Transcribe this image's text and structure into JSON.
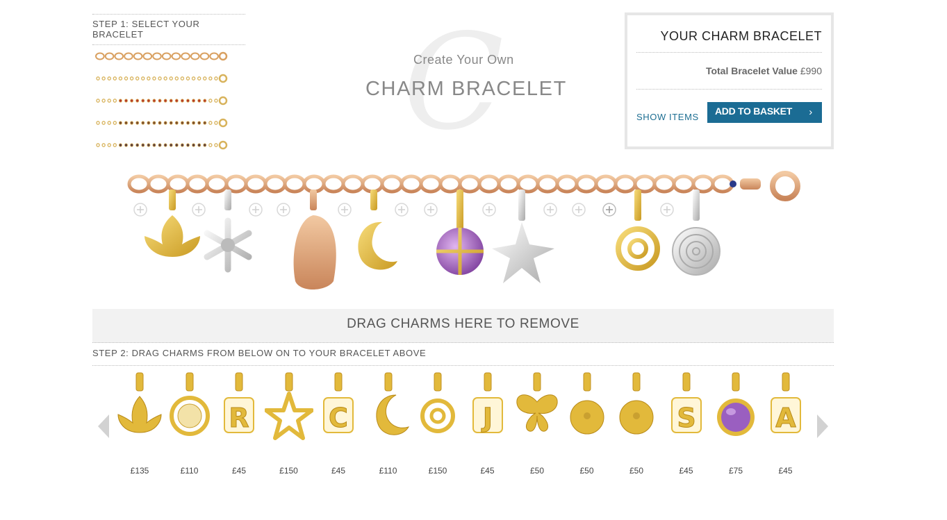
{
  "step1": {
    "title": "STEP 1: SELECT YOUR BRACELET",
    "bracelets": [
      {
        "name": "gold-chain",
        "color": "#d9a060"
      },
      {
        "name": "fine-gold-chain",
        "color": "#d4b060"
      },
      {
        "name": "coral-bead-chain",
        "color": "#b83a28"
      },
      {
        "name": "smoky-bead-chain",
        "color": "#7a4a2a"
      },
      {
        "name": "dark-bead-chain",
        "color": "#5a3a3a"
      }
    ]
  },
  "hero": {
    "line1": "Create Your Own",
    "line2": "CHARM BRACELET",
    "watermark": "C"
  },
  "basket": {
    "title": "YOUR CHARM BRACELET",
    "total_label": "Total Bracelet Value",
    "total_value": "£990",
    "show_items": "SHOW ITEMS",
    "add_to_basket": "ADD TO BASKET",
    "chevron": "›"
  },
  "remove_zone": "DRAG CHARMS HERE TO REMOVE",
  "step2": {
    "title": "STEP 2: DRAG CHARMS FROM BELOW ON TO YOUR BRACELET ABOVE"
  },
  "charms": [
    {
      "icon": "lotus-charm-icon",
      "price": "£135"
    },
    {
      "icon": "disc-charm-icon",
      "price": "£110"
    },
    {
      "icon": "letter-r-charm-icon",
      "letter": "R",
      "price": "£45"
    },
    {
      "icon": "star-charm-icon",
      "price": "£150"
    },
    {
      "icon": "letter-c-charm-icon",
      "letter": "C",
      "price": "£45"
    },
    {
      "icon": "moon-charm-icon",
      "price": "£110"
    },
    {
      "icon": "knot-charm-icon",
      "price": "£150"
    },
    {
      "icon": "letter-j-charm-icon",
      "letter": "J",
      "price": "£45"
    },
    {
      "icon": "butterfly-charm-icon",
      "price": "£50"
    },
    {
      "icon": "coin-charm-icon",
      "price": "£50"
    },
    {
      "icon": "coin-charm-icon",
      "price": "£50"
    },
    {
      "icon": "letter-s-charm-icon",
      "letter": "S",
      "price": "£45"
    },
    {
      "icon": "amethyst-charm-icon",
      "price": "£75"
    },
    {
      "icon": "letter-a-charm-icon",
      "letter": "A",
      "price": "£45"
    }
  ],
  "colors": {
    "gold": "#e2b93b",
    "rose_gold": "#d8926a",
    "silver": "#c8c8c8",
    "accent_blue": "#1b6c94",
    "amethyst": "#9a5fc0"
  }
}
